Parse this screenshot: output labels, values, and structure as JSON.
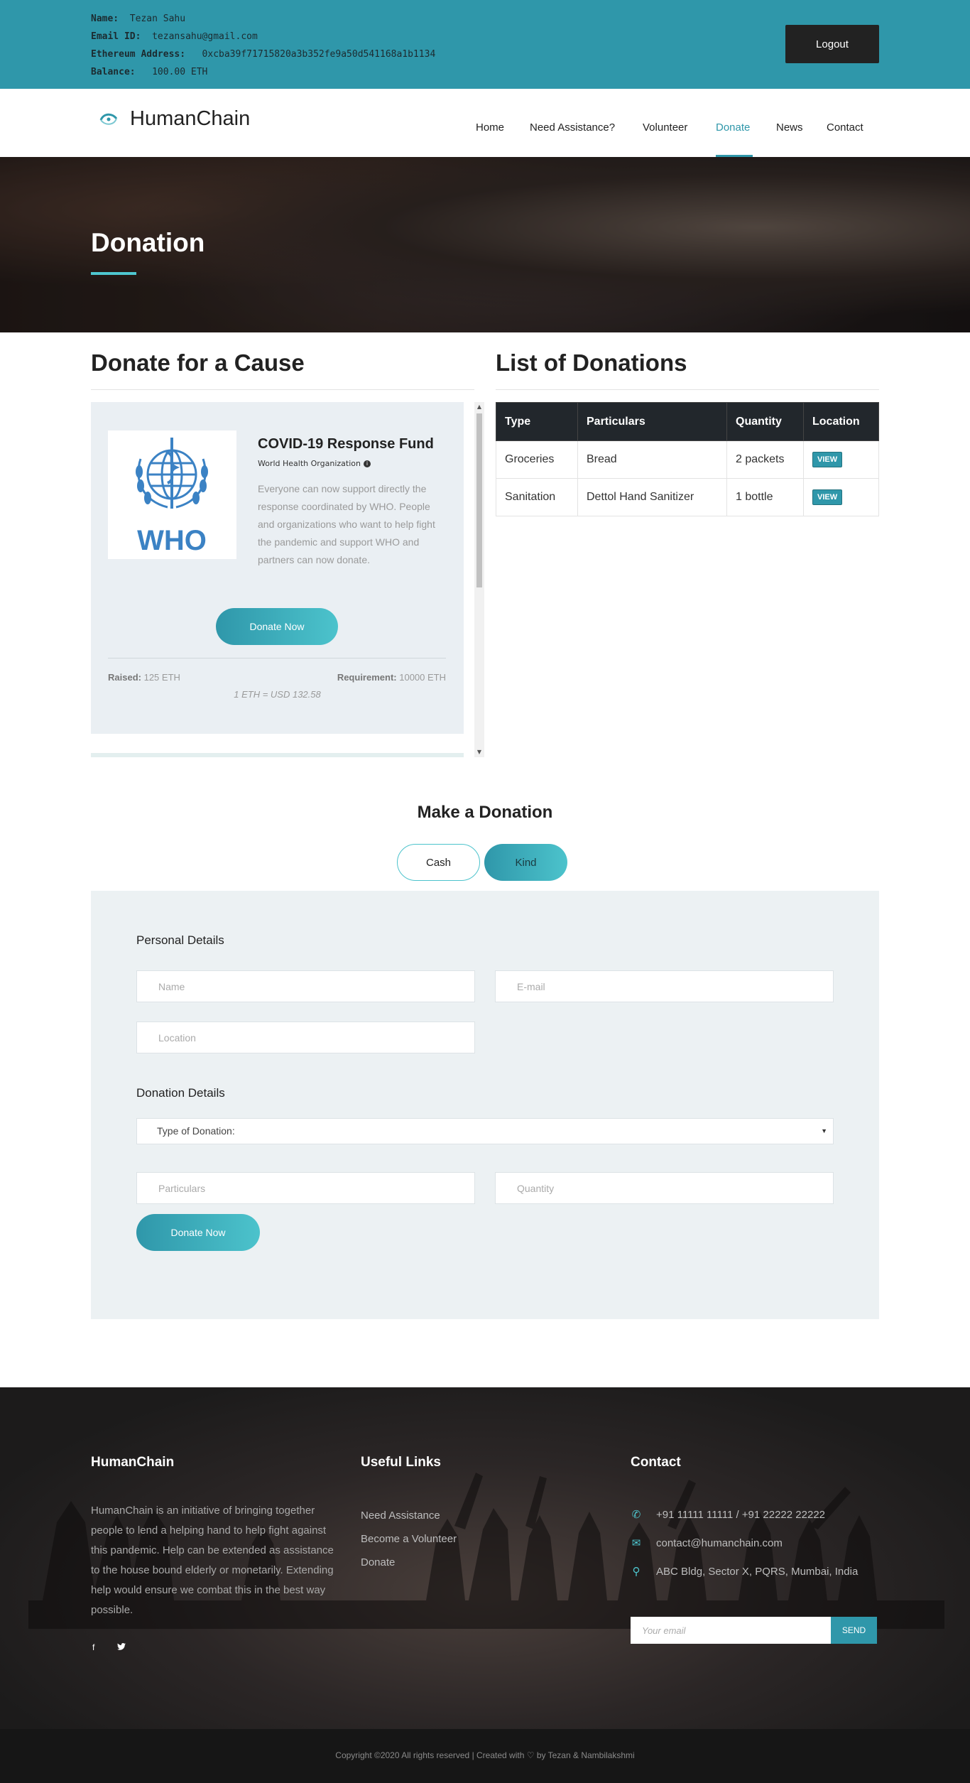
{
  "account": {
    "name_label": "Name:",
    "name": "Tezan Sahu",
    "email_label": "Email ID:",
    "email": "tezansahu@gmail.com",
    "address_label": "Ethereum Address:",
    "address": "0xcba39f71715820a3b352fe9a50d541168a1b1134",
    "balance_label": "Balance:",
    "balance": "100.00 ETH",
    "logout_label": "Logout"
  },
  "nav": {
    "brand": "HumanChain",
    "links": [
      "Home",
      "Need Assistance?",
      "Volunteer",
      "Donate",
      "News",
      "Contact"
    ],
    "active": "Donate"
  },
  "hero": {
    "title": "Donation"
  },
  "cause_section": {
    "title": "Donate for a Cause",
    "card": {
      "logo_text": "WHO",
      "title": "COVID-19 Response Fund",
      "org": "World Health Organization",
      "description": "Everyone can now support directly the response coordinated by WHO. People and organizations who want to help fight the pandemic and support WHO and partners can now donate.",
      "button": "Donate Now",
      "raised_label": "Raised:",
      "raised": "125 ETH",
      "requirement_label": "Requirement:",
      "requirement": "10000 ETH",
      "rate": "1 ETH = USD 132.58"
    }
  },
  "donations_section": {
    "title": "List of Donations",
    "headers": [
      "Type",
      "Particulars",
      "Quantity",
      "Location"
    ],
    "rows": [
      {
        "type": "Groceries",
        "particulars": "Bread",
        "quantity": "2 packets",
        "location": "VIEW"
      },
      {
        "type": "Sanitation",
        "particulars": "Dettol Hand Sanitizer",
        "quantity": "1 bottle",
        "location": "VIEW"
      }
    ]
  },
  "make_donation": {
    "title": "Make a Donation",
    "tabs": [
      "Cash",
      "Kind"
    ],
    "active_tab": "Kind",
    "personal_heading": "Personal Details",
    "name_placeholder": "Name",
    "email_placeholder": "E-mail",
    "location_placeholder": "Location",
    "donation_heading": "Donation Details",
    "type_select": "Type of Donation:",
    "particulars_placeholder": "Particulars",
    "quantity_placeholder": "Quantity",
    "submit": "Donate Now"
  },
  "footer": {
    "about_title": "HumanChain",
    "about_text": "HumanChain is an initiative of bringing together people to lend a helping hand to help fight against this pandemic. Help can be extended as assistance to the house bound elderly or monetarily. Extending help would ensure we combat this in the best way possible.",
    "social": [
      "f",
      "t"
    ],
    "links_title": "Useful Links",
    "links": [
      "Need Assistance",
      "Become a Volunteer",
      "Donate"
    ],
    "contact_title": "Contact",
    "phone": "+91 11111 11111 / +91 22222 22222",
    "email": "contact@humanchain.com",
    "address": "ABC Bldg, Sector X, PQRS, Mumbai, India",
    "newsletter_placeholder": "Your email",
    "send": "SEND",
    "copyright_pre": "Copyright ©2020 All rights reserved | Created with",
    "copyright_post": "by Tezan & Nambilakshmi"
  },
  "colors": {
    "accent": "#2f97aa",
    "accent_light": "#4cc3cc",
    "dark": "#222222"
  }
}
